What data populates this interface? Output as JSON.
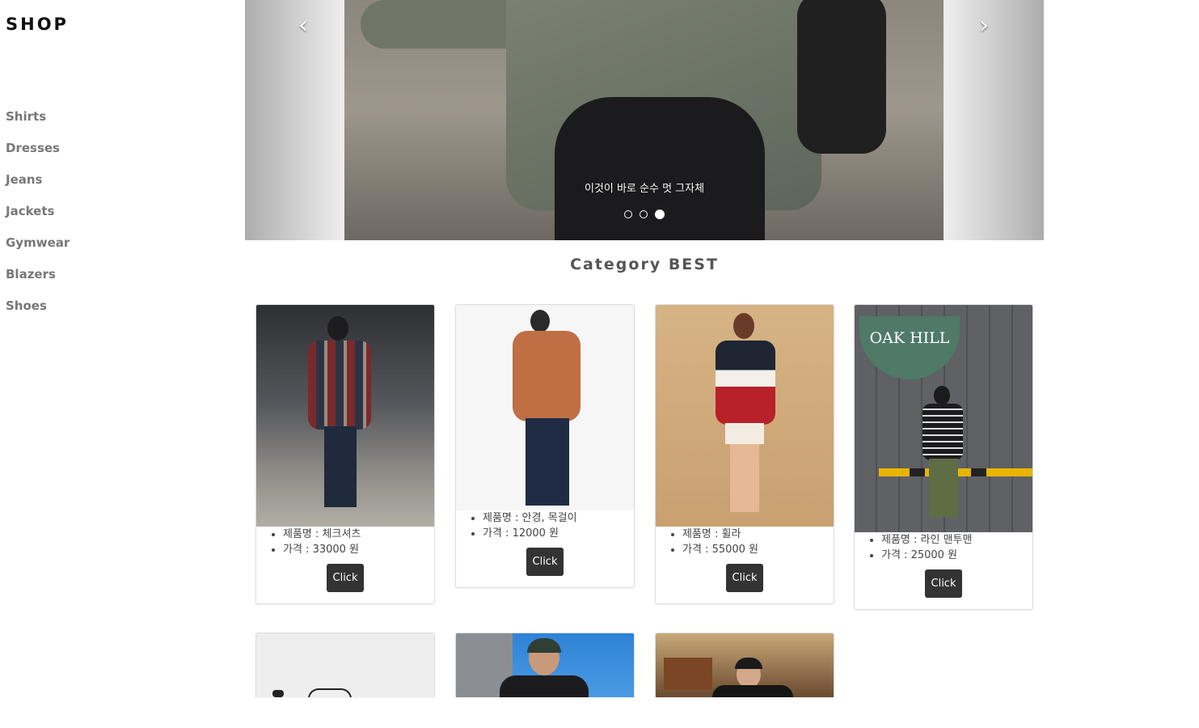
{
  "brand": "SHOP",
  "sidebar": {
    "items": [
      "Shirts",
      "Dresses",
      "Jeans",
      "Jackets",
      "Gymwear",
      "Blazers",
      "Shoes"
    ]
  },
  "carousel": {
    "caption": "이것이 바로 순수 멋 그자체",
    "prev_icon": "‹",
    "next_icon": "›",
    "slide_count": 3,
    "active_index": 2
  },
  "section": {
    "title": "Category BEST"
  },
  "products": [
    {
      "name": "제품명 : 체크셔츠",
      "price": "가격 : 33000 원",
      "button": "Click"
    },
    {
      "name": "제품명 : 안경, 목걸이",
      "price": "가격 : 12000 원",
      "button": "Click"
    },
    {
      "name": "제품명 : 휠라",
      "price": "가격 : 55000 원",
      "button": "Click"
    },
    {
      "name": "제품명 : 라인 맨투맨",
      "price": "가격 : 25000 원",
      "button": "Click"
    }
  ],
  "photo_text": {
    "sign_title": "OAK HILL"
  }
}
